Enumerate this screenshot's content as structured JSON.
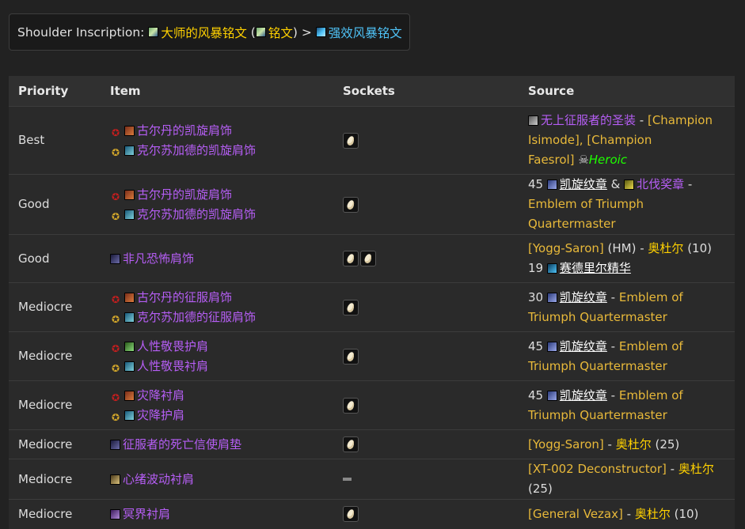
{
  "header": {
    "label": "Shoulder Inscription",
    "colon": ":",
    "primary": "大师的风暴铭文",
    "open_paren": "(",
    "variant": "铭文",
    "close_paren": ")",
    "sep": ">",
    "secondary": "强效风暴铭文"
  },
  "table": {
    "headers": {
      "priority": "Priority",
      "item": "Item",
      "sockets": "Sockets",
      "source": "Source"
    },
    "rows": [
      {
        "priority": "Best",
        "items": [
          "古尔丹的凯旋肩饰",
          "克尔苏加德的凯旋肩饰"
        ],
        "source": {
          "line1_icon_link": "无上征服者的圣装",
          "line1_dash": " - ",
          "line1_rest": "[Champion",
          "line2": "Isimode], [Champion",
          "line3": "Faesrol]",
          "heroic": "Heroic"
        }
      },
      {
        "priority": "Good",
        "items": [
          "古尔丹的凯旋肩饰",
          "克尔苏加德的凯旋肩饰"
        ],
        "source": {
          "count": "45",
          "currency": "凯旋纹章",
          "amp": " & ",
          "second_currency": "北伐奖章",
          "dash": " -",
          "vendor": "Emblem of Triumph Quartermaster"
        }
      },
      {
        "priority": "Good",
        "items": [
          "非凡恐怖肩饰"
        ],
        "source": {
          "boss": "[Yogg-Saron]",
          "mode": " (HM) - ",
          "zone": "奥杜尔",
          "size": " (10)",
          "count": "19",
          "currency": "赛德里尔精华"
        }
      },
      {
        "priority": "Mediocre",
        "items": [
          "古尔丹的征服肩饰",
          "克尔苏加德的征服肩饰"
        ],
        "source": {
          "count": "30",
          "currency": "凯旋纹章",
          "dash": " - ",
          "vendor1": "Emblem of",
          "vendor2": "Triumph Quartermaster"
        }
      },
      {
        "priority": "Mediocre",
        "items": [
          "人性敬畏护肩",
          "人性敬畏衬肩"
        ],
        "source": {
          "count": "45",
          "currency": "凯旋纹章",
          "dash": " - ",
          "vendor1": "Emblem of",
          "vendor2": "Triumph Quartermaster"
        }
      },
      {
        "priority": "Mediocre",
        "items": [
          "灾降衬肩",
          "灾降护肩"
        ],
        "source": {
          "count": "45",
          "currency": "凯旋纹章",
          "dash": " - ",
          "vendor1": "Emblem of",
          "vendor2": "Triumph Quartermaster"
        }
      },
      {
        "priority": "Mediocre",
        "items": [
          "征服者的死亡信使肩垫"
        ],
        "source": {
          "boss": "[Yogg-Saron]",
          "dash": " - ",
          "zone": "奥杜尔",
          "size": " (25)"
        }
      },
      {
        "priority": "Mediocre",
        "items": [
          "心绪波动衬肩"
        ],
        "source": {
          "boss": "[XT-002 Deconstructor]",
          "dash": " - ",
          "zone": "奥杜尔",
          "size": " (25)"
        }
      },
      {
        "priority": "Mediocre",
        "items": [
          "冥界衬肩"
        ],
        "source": {
          "boss": "[General Vezax]",
          "dash": " - ",
          "zone": "奥杜尔",
          "size": " (10)"
        }
      }
    ]
  },
  "colors": {
    "gold": "#ffd100",
    "cyan": "#4fc3f7",
    "epic_purple": "#b65ef5",
    "heroic_green": "#1eff00",
    "vendor_gold": "#e8b93a",
    "background": "#222222"
  }
}
